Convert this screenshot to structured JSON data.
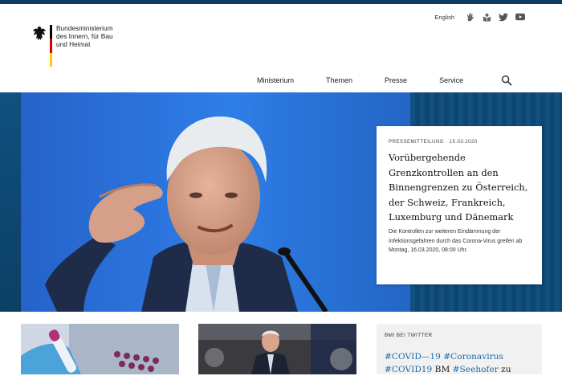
{
  "header": {
    "logo_lines": [
      "Bundesministerium",
      "des Innern, für Bau",
      "und Heimat"
    ],
    "language_link": "English",
    "icons": [
      "sign-language-icon",
      "easy-language-icon",
      "twitter-icon",
      "youtube-icon"
    ],
    "flag_colors": [
      "#000000",
      "#dd0000",
      "#ffce00"
    ]
  },
  "nav": {
    "items": [
      "Ministerium",
      "Themen",
      "Presse",
      "Service"
    ],
    "search_icon": "search-icon"
  },
  "hero": {
    "kicker": "PRESSEMITTEILUNG · 15.03.2020",
    "title": "Vorübergehende Grenzkontrollen an den Binnengrenzen zu Österreich, der Schweiz, Frankreich, Luxemburg und Dänemark",
    "teaser": "Die Kontrollen zur weiteren Eindämmung der Infektionsgefahren durch das Corona-Virus greifen ab Montag, 16.03.2020, 08:00 Uhr."
  },
  "twitter": {
    "heading": "BMI BEI TWITTER",
    "tweet_parts": [
      "#COVID—19",
      " ",
      "#Coronavirus",
      " ",
      "#COVID19",
      " BM ",
      "#Seehofer",
      " zu"
    ]
  },
  "colors": {
    "topbar": "#0b3d63",
    "hero_bg": "#0f4c7a",
    "hashtag": "#1c6aa8"
  }
}
